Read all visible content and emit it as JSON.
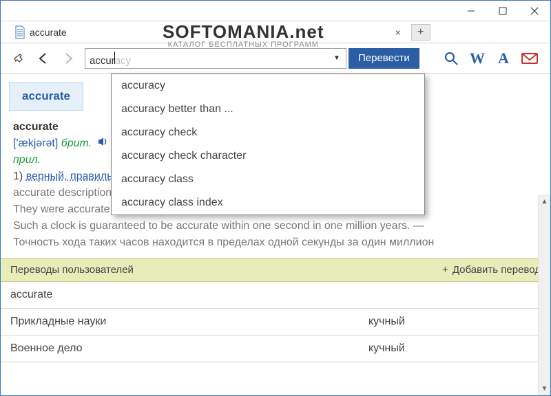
{
  "tab": {
    "title": "accurate"
  },
  "search": {
    "typed": "accur",
    "rest": "acy",
    "translate_btn": "Перевести"
  },
  "suggestions": [
    "accuracy",
    "accuracy better than ...",
    "accuracy check",
    "accuracy check character",
    "accuracy class",
    "accuracy class index"
  ],
  "entry": {
    "word_tab": "accurate",
    "headword": "accurate",
    "ipa": "['ækjərət]",
    "brit": "брит.",
    "pos": "прил.",
    "sense_num": "1)",
    "sense_links": "верный, правильный",
    "example1": "accurate description — точное описание",
    "example2": "They were accurate in their prediction. — Они оказались правы в своих прогнозах.",
    "example3": "Such a clock is guaranteed to be accurate within one second in one million years. —",
    "example4": "Точность хода таких часов находится в пределах одной секунды за один миллион"
  },
  "user": {
    "header": "Переводы пользователей",
    "add": "Добавить перевод",
    "word": "accurate",
    "rows": [
      {
        "domain": "Прикладные науки",
        "value": "кучный"
      },
      {
        "domain": "Военное дело",
        "value": "кучный"
      }
    ]
  },
  "watermark": {
    "line1": "SOFTOMANIA.net",
    "line2": "КАТАЛОГ БЕСПЛАТНЫХ ПРОГРАММ"
  }
}
